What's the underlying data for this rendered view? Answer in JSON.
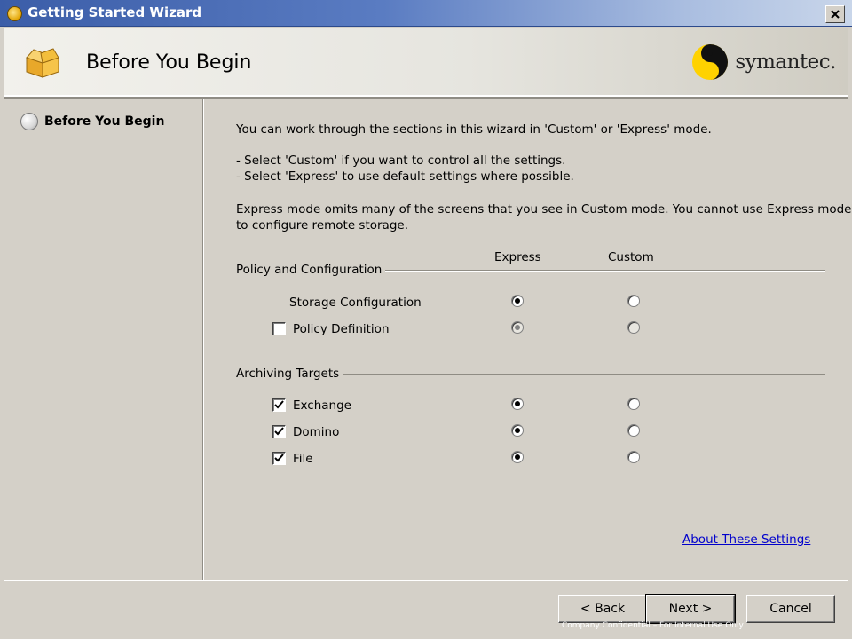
{
  "window": {
    "title": "Getting Started Wizard"
  },
  "header": {
    "title": "Before You Begin",
    "logo_text": "symantec."
  },
  "sidebar": {
    "items": [
      {
        "label": "Before You Begin"
      }
    ]
  },
  "content": {
    "intro": "You can work through the sections in this wizard in 'Custom' or 'Express' mode.",
    "bullet_custom": "- Select 'Custom' if you want to control all the settings.",
    "bullet_express": "- Select 'Express' to use default settings where possible.",
    "express_note_1": "Express mode omits many of the screens that you see in Custom mode. You cannot use Express mode",
    "express_note_2": "to configure remote storage.",
    "columns": {
      "express": "Express",
      "custom": "Custom"
    },
    "policy_group": {
      "title": "Policy and Configuration",
      "rows": [
        {
          "label": "Storage Configuration",
          "has_checkbox": false,
          "checked": false,
          "mode": "Express",
          "enabled": true
        },
        {
          "label": "Policy Definition",
          "has_checkbox": true,
          "checked": false,
          "mode": "Express",
          "enabled": false
        }
      ]
    },
    "archiving_group": {
      "title": "Archiving Targets",
      "rows": [
        {
          "label": "Exchange",
          "has_checkbox": true,
          "checked": true,
          "mode": "Express",
          "enabled": true
        },
        {
          "label": "Domino",
          "has_checkbox": true,
          "checked": true,
          "mode": "Express",
          "enabled": true
        },
        {
          "label": "File",
          "has_checkbox": true,
          "checked": true,
          "mode": "Express",
          "enabled": true
        }
      ]
    },
    "link": "About These Settings"
  },
  "buttons": {
    "back": "< Back",
    "next": "Next >",
    "cancel": "Cancel"
  },
  "watermark": "Company Confidential – For Internal Use Only",
  "icons": {
    "title": "wizard-app-icon",
    "close": "close-icon",
    "header": "open-box-icon",
    "logo": "symantec-logo-icon"
  },
  "colors": {
    "titlebar": "#3b5da8",
    "link": "#0000cc",
    "dialog": "#d4d0c8"
  }
}
